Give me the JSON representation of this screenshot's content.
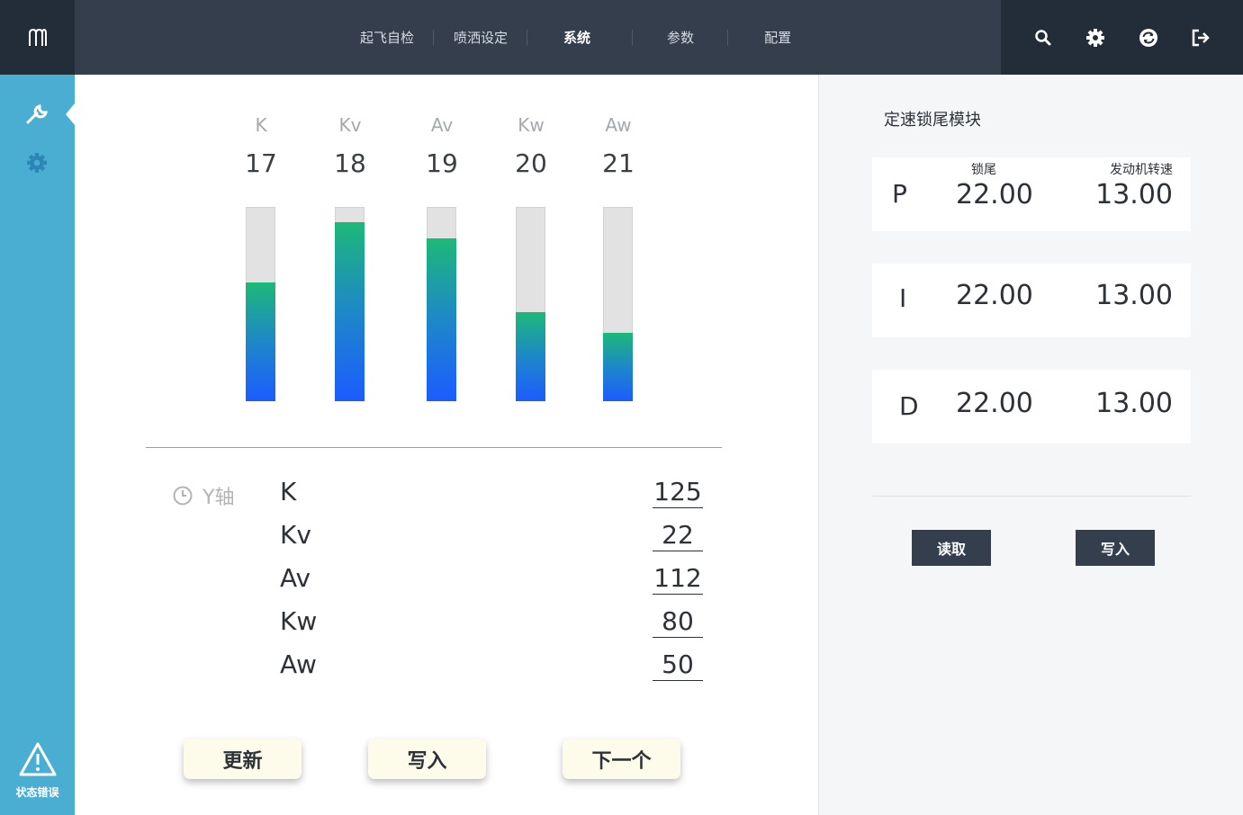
{
  "nav": {
    "items": [
      "起飞自检",
      "喷洒设定",
      "系统",
      "参数",
      "配置"
    ],
    "active": "系统"
  },
  "tools": [
    "search-icon",
    "gear-icon",
    "sync-icon",
    "logout-icon"
  ],
  "sidebar": {
    "items": [
      "wrench-icon",
      "gear-icon"
    ],
    "status_label": "状态错误"
  },
  "bars": {
    "labels": [
      "K",
      "Kv",
      "Av",
      "Kw",
      "Aw"
    ],
    "values": [
      "17",
      "18",
      "19",
      "20",
      "21"
    ],
    "fill_fraction": [
      0.61,
      0.92,
      0.84,
      0.46,
      0.35
    ]
  },
  "params": {
    "axis_label": "Y轴",
    "rows": [
      {
        "name": "K",
        "value": "125"
      },
      {
        "name": "Kv",
        "value": "22"
      },
      {
        "name": "Av",
        "value": "112"
      },
      {
        "name": "Kw",
        "value": "80"
      },
      {
        "name": "Aw",
        "value": "50"
      }
    ]
  },
  "buttons": {
    "update": "更新",
    "write": "写入",
    "next": "下一个"
  },
  "module": {
    "title": "定速锁尾模块",
    "col1": "锁尾",
    "col2": "发动机转速",
    "rows": [
      {
        "name": "P",
        "v1": "22.00",
        "v2": "13.00"
      },
      {
        "name": "I",
        "v1": "22.00",
        "v2": "13.00"
      },
      {
        "name": "D",
        "v1": "22.00",
        "v2": "13.00"
      }
    ],
    "read_label": "读取",
    "write_label": "写入"
  },
  "colors": {
    "topbar": "#343e4c",
    "sidebar": "#4aaed3",
    "bar_top": "#1eb878",
    "bar_bottom": "#1c5cff",
    "button_bg": "#fdfbe9"
  }
}
